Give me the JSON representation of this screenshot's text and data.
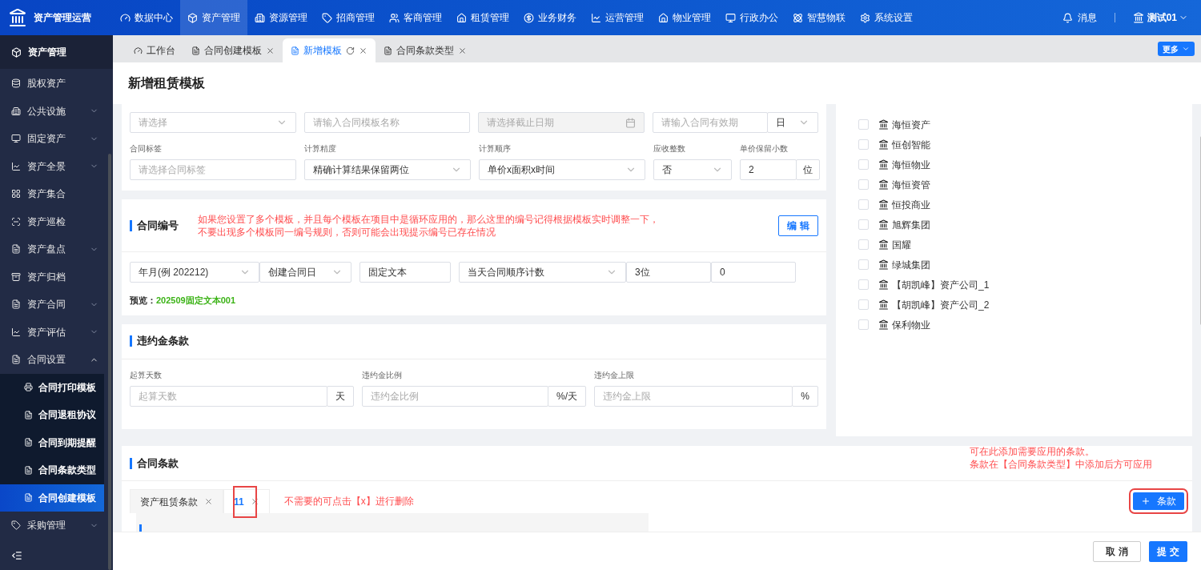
{
  "brand": {
    "title": "资产管理运营"
  },
  "top_nav": [
    {
      "label": "数据中心",
      "selected": false
    },
    {
      "label": "资产管理",
      "selected": true
    },
    {
      "label": "资源管理",
      "selected": false
    },
    {
      "label": "招商管理",
      "selected": false
    },
    {
      "label": "客商管理",
      "selected": false
    },
    {
      "label": "租赁管理",
      "selected": false
    },
    {
      "label": "业务财务",
      "selected": false
    },
    {
      "label": "运营管理",
      "selected": false
    },
    {
      "label": "物业管理",
      "selected": false
    },
    {
      "label": "行政办公",
      "selected": false
    },
    {
      "label": "智慧物联",
      "selected": false
    },
    {
      "label": "系统设置",
      "selected": false
    }
  ],
  "header_right": {
    "messages": "消息",
    "user": "测试01"
  },
  "sidebar": {
    "title": "资产管理",
    "items": [
      {
        "label": "股权资产",
        "kind": "link"
      },
      {
        "label": "公共设施",
        "kind": "group",
        "expanded": false
      },
      {
        "label": "固定资产",
        "kind": "group",
        "expanded": false
      },
      {
        "label": "资产全景",
        "kind": "group",
        "expanded": false
      },
      {
        "label": "资产集合",
        "kind": "link"
      },
      {
        "label": "资产巡检",
        "kind": "link"
      },
      {
        "label": "资产盘点",
        "kind": "group",
        "expanded": false
      },
      {
        "label": "资产归档",
        "kind": "link"
      },
      {
        "label": "资产合同",
        "kind": "group",
        "expanded": false
      },
      {
        "label": "资产评估",
        "kind": "group",
        "expanded": false
      },
      {
        "label": "合同设置",
        "kind": "group",
        "expanded": true,
        "children": [
          {
            "label": "合同打印模板",
            "selected": false
          },
          {
            "label": "合同退租协议",
            "selected": false
          },
          {
            "label": "合同到期提醒",
            "selected": false
          },
          {
            "label": "合同条款类型",
            "selected": false
          },
          {
            "label": "合同创建模板",
            "selected": true
          }
        ]
      },
      {
        "label": "采购管理",
        "kind": "group",
        "expanded": false
      }
    ]
  },
  "tabs": [
    {
      "label": "工作台",
      "selected": false,
      "closable": false
    },
    {
      "label": "合同创建模板",
      "selected": false,
      "closable": true
    },
    {
      "label": "新增模板",
      "selected": true,
      "closable": true
    },
    {
      "label": "合同条款类型",
      "selected": false,
      "closable": true
    }
  ],
  "more_button": "更多",
  "page_title": "新增租赁模板",
  "basic_fields_row1": [
    {
      "kind": "select",
      "placeholder": "请选择"
    },
    {
      "kind": "input",
      "placeholder": "请输入合同模板名称"
    },
    {
      "kind": "date",
      "placeholder": "请选择截止日期",
      "disabled": true
    },
    {
      "kind": "input_unit_select",
      "placeholder": "请输入合同有效期",
      "unit": "日"
    }
  ],
  "basic_fields_row2": [
    {
      "label": "合同标签",
      "kind": "input",
      "placeholder": "请选择合同标签"
    },
    {
      "label": "计算精度",
      "kind": "select",
      "value": "精确计算结果保留两位"
    },
    {
      "label": "计算顺序",
      "kind": "select",
      "value": "单价x面积x时间"
    },
    {
      "label": "应收整数",
      "kind": "select",
      "value": "否"
    },
    {
      "label": "单价保留小数",
      "kind": "input_unit",
      "value": "2",
      "unit": "位"
    }
  ],
  "numbering": {
    "title": "合同编号",
    "note_lines": [
      "如果您设置了多个模板，并且每个模板在项目中是循环应用的，那么这里的编号记得根据模板实时调整一下，",
      "不要出现多个模板同一编号规则，否则可能会出现提示编号已存在情况"
    ],
    "edit_button": "编 辑",
    "parts": [
      {
        "kind": "select",
        "value": "年月(例 202212)"
      },
      {
        "kind": "select",
        "value": "创建合同日"
      },
      {
        "kind": "input",
        "value": "固定文本"
      },
      {
        "kind": "select",
        "value": "当天合同顺序计数"
      },
      {
        "kind": "input",
        "value": "3位"
      },
      {
        "kind": "input",
        "value": "0"
      }
    ],
    "preview_label": "预览：",
    "preview_value": "202509固定文本001"
  },
  "penalty": {
    "title": "违约金条款",
    "fields": [
      {
        "label": "起算天数",
        "placeholder": "起算天数",
        "unit": "天"
      },
      {
        "label": "违约金比例",
        "placeholder": "违约金比例",
        "unit": "%/天"
      },
      {
        "label": "违约金上限",
        "placeholder": "违约金上限",
        "unit": "%"
      }
    ]
  },
  "companies": [
    {
      "name": "海恒资产",
      "checked": false
    },
    {
      "name": "恒创智能",
      "checked": false
    },
    {
      "name": "海恒物业",
      "checked": false
    },
    {
      "name": "海恒资管",
      "checked": false
    },
    {
      "name": "恒投商业",
      "checked": false
    },
    {
      "name": "旭辉集团",
      "checked": false
    },
    {
      "name": "国耀",
      "checked": false
    },
    {
      "name": "绿城集团",
      "checked": false
    },
    {
      "name": "【胡凯峰】资产公司_1",
      "checked": false
    },
    {
      "name": "【胡凯峰】资产公司_2",
      "checked": false
    },
    {
      "name": "保利物业",
      "checked": false
    }
  ],
  "clauses": {
    "title": "合同条款",
    "note_lines": [
      "可在此添加需要应用的条款。",
      "条款在【合同条款类型】中添加后方可应用"
    ],
    "tabs": [
      {
        "label": "资产租赁条款",
        "selected": false
      },
      {
        "label": "11",
        "selected": true
      }
    ],
    "delete_note": "不需要的可点击【x】进行删除",
    "add_button": "条款"
  },
  "footer": {
    "cancel": "取 消",
    "submit": "提 交"
  }
}
